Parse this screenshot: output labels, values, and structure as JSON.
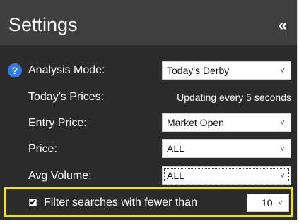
{
  "header": {
    "title": "Settings",
    "collapse_glyph": "«"
  },
  "rows": {
    "analysis_mode": {
      "label": "Analysis Mode:",
      "value": "Today's Derby"
    },
    "todays_prices": {
      "label": "Today's Prices:",
      "value": "Updating every 5 seconds"
    },
    "entry_price": {
      "label": "Entry Price:",
      "value": "Market Open"
    },
    "price": {
      "label": "Price:",
      "value": "ALL"
    },
    "avg_volume": {
      "label": "Avg Volume:",
      "value": "ALL"
    }
  },
  "filter": {
    "checked_glyph": "✔",
    "label": "Filter searches with fewer than",
    "value": "10"
  },
  "icons": {
    "help": "?",
    "chevron": "˅"
  },
  "colors": {
    "panel_bg": "#2b2b2b",
    "header_bg": "#3f3f3f",
    "help_icon": "#2f7de1",
    "highlight": "#f5e60a"
  }
}
